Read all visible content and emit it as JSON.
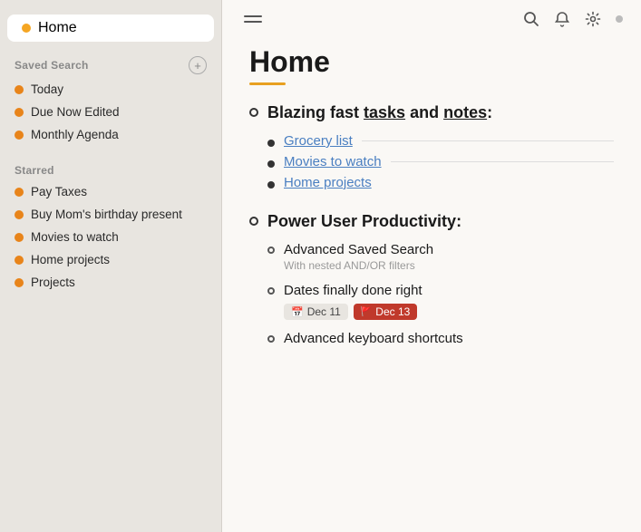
{
  "sidebar": {
    "home_label": "Home",
    "saved_search_title": "Saved Search",
    "add_button_label": "+",
    "saved_search_items": [
      {
        "label": "Today"
      },
      {
        "label": "Due Now Edited"
      },
      {
        "label": "Monthly Agenda"
      }
    ],
    "starred_title": "Starred",
    "starred_items": [
      {
        "label": "Pay Taxes"
      },
      {
        "label": "Buy Mom's birthday present"
      },
      {
        "label": "Movies to watch"
      },
      {
        "label": "Home projects"
      },
      {
        "label": "Projects"
      }
    ]
  },
  "topbar": {
    "search_icon": "🔍",
    "bell_icon": "🔔",
    "gear_icon": "⚙"
  },
  "main": {
    "page_title": "Home",
    "section1": {
      "heading_prefix": "Blazing fast ",
      "heading_tasks": "tasks",
      "heading_mid": " and ",
      "heading_notes": "notes",
      "heading_suffix": ":",
      "links": [
        {
          "label": "Grocery list"
        },
        {
          "label": "Movies to watch"
        },
        {
          "label": "Home projects"
        }
      ]
    },
    "section2": {
      "heading": "Power User Productivity:",
      "items": [
        {
          "title": "Advanced Saved Search",
          "subtitle": "With nested AND/OR filters",
          "dates": null
        },
        {
          "title": "Dates finally done right",
          "subtitle": null,
          "date1": "Dec 11",
          "date2": "Dec 13"
        },
        {
          "title": "Advanced keyboard shortcuts",
          "subtitle": null,
          "dates": null
        }
      ]
    }
  }
}
